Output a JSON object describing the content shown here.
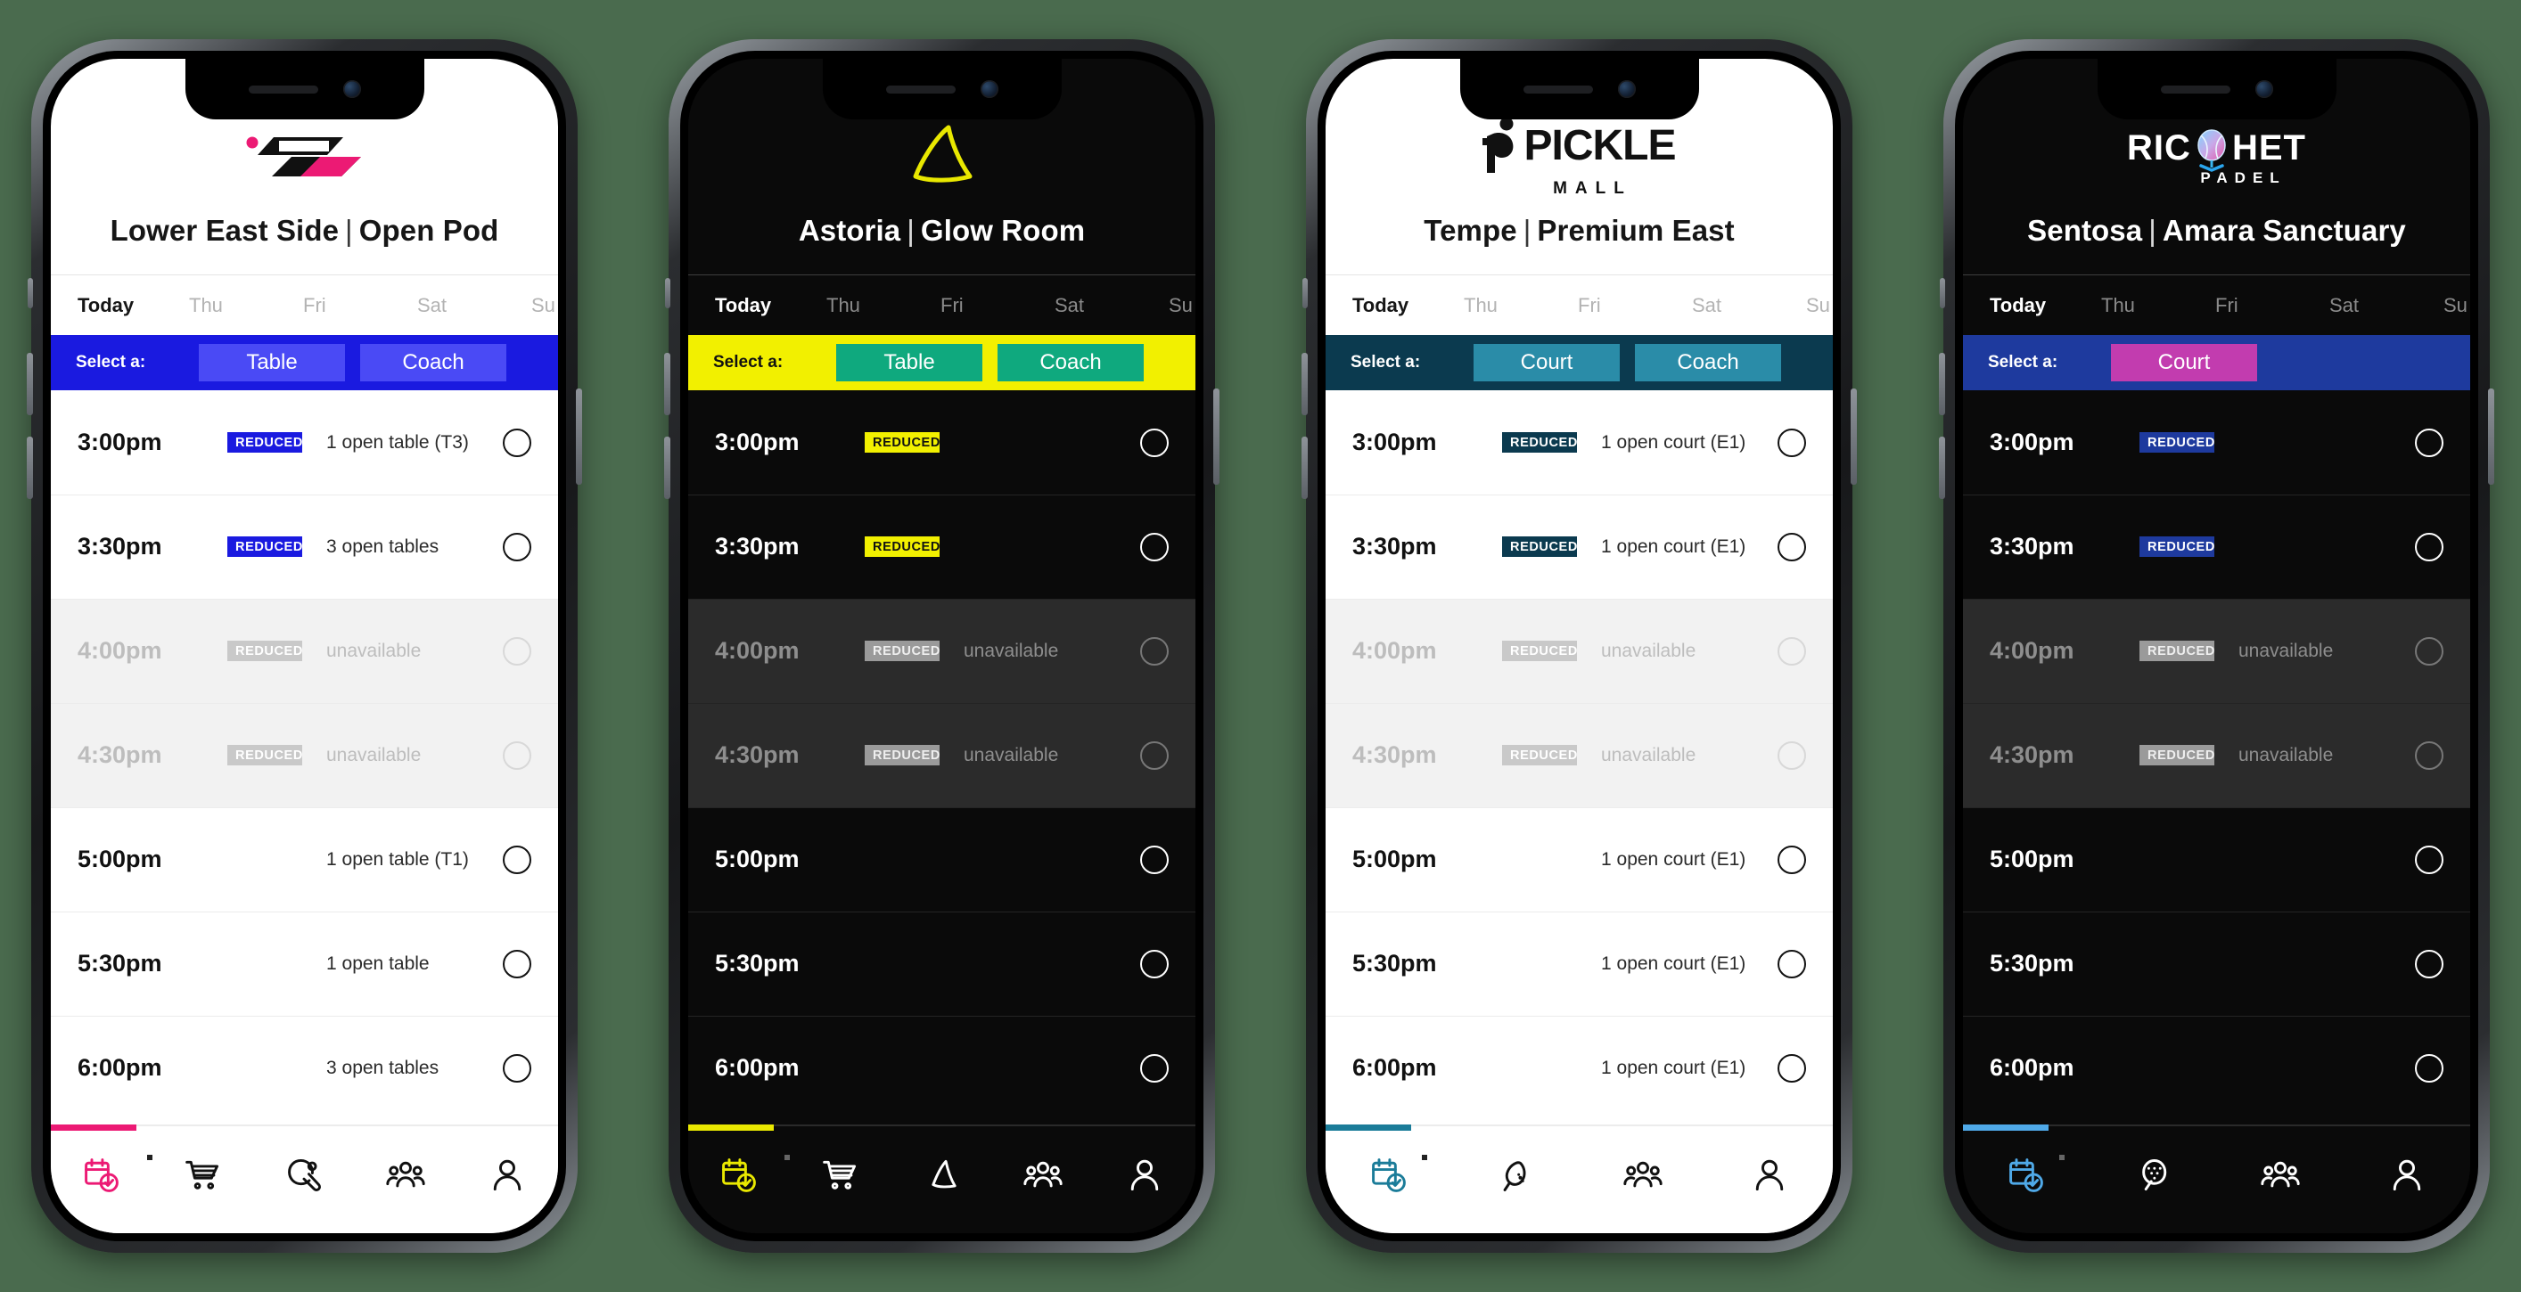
{
  "phones": [
    {
      "id": "lower-east-side",
      "theme": "light",
      "brand_name": "Swoosh Club",
      "logo": "swoosh-logo",
      "venue_city": "Lower East Side",
      "venue_room": "Open Pod",
      "separator": "|",
      "colors": {
        "accent": "#EC1A74",
        "bar_bg": "#1A1AE0",
        "bar_text": "#FFFFFF",
        "seg_bg": "#4A4AF5",
        "seg_text": "#FFFFFF",
        "badge_bg": "#1A1AE0",
        "badge_text": "#FFFFFF"
      },
      "days": [
        "Today",
        "Thu",
        "Fri",
        "Sat",
        "Su"
      ],
      "select_label": "Select a:",
      "segments": [
        "Table",
        "Coach"
      ],
      "slots": [
        {
          "time": "3:00pm",
          "badge": "REDUCED",
          "availability": "1 open table (T3)",
          "unavailable": false
        },
        {
          "time": "3:30pm",
          "badge": "REDUCED",
          "availability": "3 open tables",
          "unavailable": false
        },
        {
          "time": "4:00pm",
          "badge": "REDUCED",
          "availability": "unavailable",
          "unavailable": true
        },
        {
          "time": "4:30pm",
          "badge": "REDUCED",
          "availability": "unavailable",
          "unavailable": true
        },
        {
          "time": "5:00pm",
          "badge": "",
          "availability": "1 open table (T1)",
          "unavailable": false
        },
        {
          "time": "5:30pm",
          "badge": "",
          "availability": "1 open table",
          "unavailable": false
        },
        {
          "time": "6:00pm",
          "badge": "",
          "availability": "3 open tables",
          "unavailable": false
        }
      ],
      "nav": [
        {
          "icon": "calendar-check-icon",
          "active": true
        },
        {
          "icon": "shopping-cart-icon",
          "active": false
        },
        {
          "icon": "ping-pong-paddle-icon",
          "active": false
        },
        {
          "icon": "people-group-icon",
          "active": false
        },
        {
          "icon": "person-icon",
          "active": false
        }
      ]
    },
    {
      "id": "astoria",
      "theme": "dark",
      "brand_name": "Glow Shark",
      "logo": "shark-fin-logo",
      "venue_city": "Astoria",
      "venue_room": "Glow Room",
      "separator": "|",
      "colors": {
        "accent": "#E9E800",
        "bar_bg": "#F2F000",
        "bar_text": "#111111",
        "seg_bg": "#0FA97E",
        "seg_text": "#FFFFFF",
        "badge_bg": "#F2F000",
        "badge_text": "#111111"
      },
      "days": [
        "Today",
        "Thu",
        "Fri",
        "Sat",
        "Su"
      ],
      "select_label": "Select a:",
      "segments": [
        "Table",
        "Coach"
      ],
      "slots": [
        {
          "time": "3:00pm",
          "badge": "REDUCED",
          "availability": "",
          "unavailable": false
        },
        {
          "time": "3:30pm",
          "badge": "REDUCED",
          "availability": "",
          "unavailable": false
        },
        {
          "time": "4:00pm",
          "badge": "REDUCED",
          "availability": "unavailable",
          "unavailable": true
        },
        {
          "time": "4:30pm",
          "badge": "REDUCED",
          "availability": "unavailable",
          "unavailable": true
        },
        {
          "time": "5:00pm",
          "badge": "",
          "availability": "",
          "unavailable": false
        },
        {
          "time": "5:30pm",
          "badge": "",
          "availability": "",
          "unavailable": false
        },
        {
          "time": "6:00pm",
          "badge": "",
          "availability": "",
          "unavailable": false
        }
      ],
      "nav": [
        {
          "icon": "calendar-check-icon",
          "active": true
        },
        {
          "icon": "shopping-cart-icon",
          "active": false
        },
        {
          "icon": "shark-fin-icon",
          "active": false
        },
        {
          "icon": "people-group-icon",
          "active": false
        },
        {
          "icon": "person-icon",
          "active": false
        }
      ]
    },
    {
      "id": "tempe",
      "theme": "light",
      "brand_name": "PICKLE MALL",
      "logo": "pickle-mall-logo",
      "logo_text_main": "PICKLE",
      "logo_text_sub": "MALL",
      "venue_city": "Tempe",
      "venue_room": "Premium East",
      "separator": "|",
      "colors": {
        "accent": "#1B7C99",
        "bar_bg": "#0B3A4F",
        "bar_text": "#FFFFFF",
        "seg_bg": "#2A8CA8",
        "seg_text": "#FFFFFF",
        "badge_bg": "#0B3A4F",
        "badge_text": "#FFFFFF"
      },
      "days": [
        "Today",
        "Thu",
        "Fri",
        "Sat",
        "Su"
      ],
      "select_label": "Select a:",
      "segments": [
        "Court",
        "Coach"
      ],
      "slots": [
        {
          "time": "3:00pm",
          "badge": "REDUCED",
          "availability": "1 open court (E1)",
          "unavailable": false
        },
        {
          "time": "3:30pm",
          "badge": "REDUCED",
          "availability": "1 open court (E1)",
          "unavailable": false
        },
        {
          "time": "4:00pm",
          "badge": "REDUCED",
          "availability": "unavailable",
          "unavailable": true
        },
        {
          "time": "4:30pm",
          "badge": "REDUCED",
          "availability": "unavailable",
          "unavailable": true
        },
        {
          "time": "5:00pm",
          "badge": "",
          "availability": "1 open court (E1)",
          "unavailable": false
        },
        {
          "time": "5:30pm",
          "badge": "",
          "availability": "1 open court (E1)",
          "unavailable": false
        },
        {
          "time": "6:00pm",
          "badge": "",
          "availability": "1 open court (E1)",
          "unavailable": false
        }
      ],
      "nav": [
        {
          "icon": "calendar-check-icon",
          "active": true
        },
        {
          "icon": "pickleball-paddle-icon",
          "active": false
        },
        {
          "icon": "people-group-icon",
          "active": false
        },
        {
          "icon": "person-icon",
          "active": false
        }
      ]
    },
    {
      "id": "sentosa",
      "theme": "dark",
      "brand_name": "RICOCHET PADEL",
      "logo": "ricochet-padel-logo",
      "logo_text_main": "RICOCHET",
      "logo_text_sub": "PADEL",
      "venue_city": "Sentosa",
      "venue_room": "Amara Sanctuary",
      "separator": "|",
      "colors": {
        "accent": "#4FA9E8",
        "bar_bg": "#1E3A9E",
        "bar_text": "#FFFFFF",
        "seg_bg": "#C23CAF",
        "seg_text": "#FFFFFF",
        "badge_bg": "#1E3A9E",
        "badge_text": "#FFFFFF"
      },
      "days": [
        "Today",
        "Thu",
        "Fri",
        "Sat",
        "Su"
      ],
      "select_label": "Select a:",
      "segments": [
        "Court"
      ],
      "slots": [
        {
          "time": "3:00pm",
          "badge": "REDUCED",
          "availability": "",
          "unavailable": false
        },
        {
          "time": "3:30pm",
          "badge": "REDUCED",
          "availability": "",
          "unavailable": false
        },
        {
          "time": "4:00pm",
          "badge": "REDUCED",
          "availability": "unavailable",
          "unavailable": true
        },
        {
          "time": "4:30pm",
          "badge": "REDUCED",
          "availability": "unavailable",
          "unavailable": true
        },
        {
          "time": "5:00pm",
          "badge": "",
          "availability": "",
          "unavailable": false
        },
        {
          "time": "5:30pm",
          "badge": "",
          "availability": "",
          "unavailable": false
        },
        {
          "time": "6:00pm",
          "badge": "",
          "availability": "",
          "unavailable": false
        }
      ],
      "nav": [
        {
          "icon": "calendar-check-icon",
          "active": true
        },
        {
          "icon": "padel-racket-search-icon",
          "active": false
        },
        {
          "icon": "people-group-icon",
          "active": false
        },
        {
          "icon": "person-icon",
          "active": false
        }
      ]
    }
  ]
}
